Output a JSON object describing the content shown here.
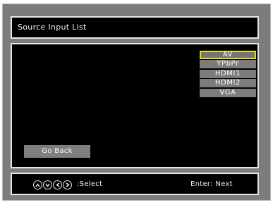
{
  "title": "Source Input List",
  "sources": [
    {
      "label": "AV",
      "selected": true
    },
    {
      "label": "YPbPr",
      "selected": false
    },
    {
      "label": "HDMI1",
      "selected": false
    },
    {
      "label": "HDMI2",
      "selected": false
    },
    {
      "label": "VGA",
      "selected": false
    }
  ],
  "go_back_label": "Go Back",
  "footer": {
    "nav_icons": [
      "up-arrow-icon",
      "down-arrow-icon",
      "left-arrow-icon",
      "right-arrow-icon"
    ],
    "select_label": ":Select",
    "next_label": "Enter: Next"
  },
  "colors": {
    "highlight": "#e8e000",
    "button": "#7c7c7c",
    "frame": "#7c7c7c",
    "panel": "#000000"
  }
}
